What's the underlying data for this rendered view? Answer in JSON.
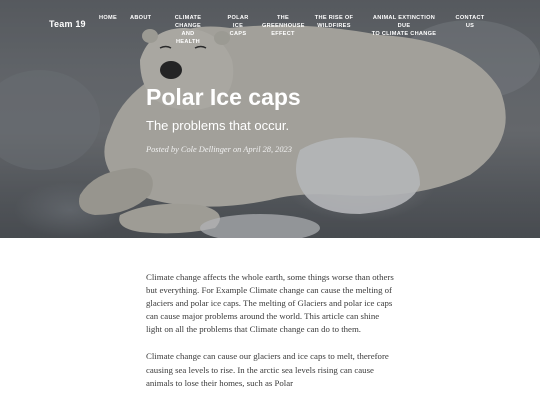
{
  "site": {
    "title": "Team 19"
  },
  "nav": {
    "items": [
      {
        "line1": "HOME",
        "line2": "",
        "line3": ""
      },
      {
        "line1": "ABOUT",
        "line2": "",
        "line3": ""
      },
      {
        "line1": "CLIMATE",
        "line2": "CHANGE AND",
        "line3": "HEALTH"
      },
      {
        "line1": "POLAR",
        "line2": "ICE",
        "line3": "CAPS"
      },
      {
        "line1": "THE",
        "line2": "GREENHOUSE",
        "line3": "EFFECT"
      },
      {
        "line1": "THE RISE OF",
        "line2": "WILDFIRES",
        "line3": ""
      },
      {
        "line1": "ANIMAL EXTINCTION DUE",
        "line2": "TO CLIMATE CHANGE",
        "line3": ""
      },
      {
        "line1": "CONTACT",
        "line2": "US",
        "line3": ""
      }
    ]
  },
  "hero": {
    "title": "Polar Ice caps",
    "subtitle": "The problems that occur.",
    "meta": "Posted by Cole Dellinger on April 28, 2023",
    "image_subject": "polar bear lying on snow and ice"
  },
  "article": {
    "paragraph1": "Climate change affects the whole earth, some things worse than others but everything. For Example Climate change can cause the melting of glaciers and polar ice caps. The melting of Glaciers and polar ice caps can cause major problems around the world. This article can shine light on all the problems that Climate change can do to them.",
    "paragraph2": "Climate change can cause our glaciers and ice caps to melt, therefore causing sea levels to rise. In the arctic sea levels rising can cause animals to lose their homes, such as Polar"
  }
}
